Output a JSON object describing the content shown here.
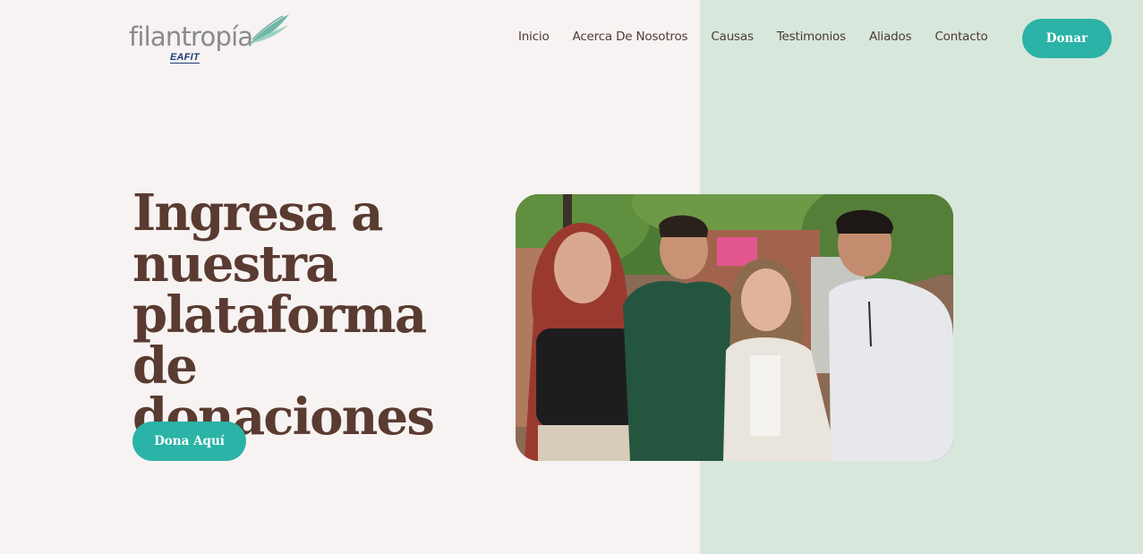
{
  "header": {
    "logo": {
      "wordmark": "filantropía",
      "subbrand": "EAFIT"
    },
    "nav": [
      {
        "label": "Inicio"
      },
      {
        "label": "Acerca De Nosotros"
      },
      {
        "label": "Causas"
      },
      {
        "label": "Testimonios"
      },
      {
        "label": "Aliados"
      },
      {
        "label": "Contacto"
      }
    ],
    "donate_label": "Donar"
  },
  "hero": {
    "title": "Ingresa a nuestra plataforma de donaciones",
    "cta_label": "Dona Aquí",
    "image_alt": "four-students-group-photo"
  },
  "colors": {
    "accent": "#2ab3a6",
    "heading": "#5a3b31",
    "nav_text": "#4e3b35",
    "bg_left": "#f7f3f2",
    "bg_right": "#d8e7db"
  }
}
